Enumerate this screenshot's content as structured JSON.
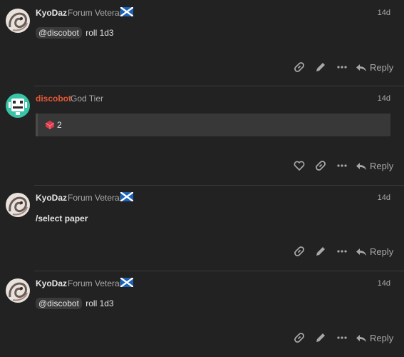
{
  "posts": [
    {
      "username": "KyoDaz",
      "title": "Forum Veteran",
      "date": "14d",
      "mention": "@discobot",
      "text": "roll 1d3",
      "reply_label": "Reply",
      "icons": [
        "link-icon",
        "pencil-icon",
        "more-icon",
        "reply-icon"
      ]
    },
    {
      "username": "discobot",
      "title": "God Tier",
      "date": "14d",
      "result": "2",
      "reply_label": "Reply",
      "icons": [
        "heart-icon",
        "link-icon",
        "more-icon",
        "reply-icon"
      ]
    },
    {
      "username": "KyoDaz",
      "title": "Forum Veteran",
      "date": "14d",
      "text": "/select paper",
      "reply_label": "Reply",
      "icons": [
        "link-icon",
        "pencil-icon",
        "more-icon",
        "reply-icon"
      ]
    },
    {
      "username": "KyoDaz",
      "title": "Forum Veteran",
      "date": "14d",
      "mention": "@discobot",
      "text": "roll 1d3",
      "reply_label": "Reply",
      "icons": [
        "link-icon",
        "pencil-icon",
        "more-icon",
        "reply-icon"
      ]
    }
  ],
  "colors": {
    "background": "#222222",
    "bot_name": "#e45735",
    "muted": "#a8a8a8"
  }
}
